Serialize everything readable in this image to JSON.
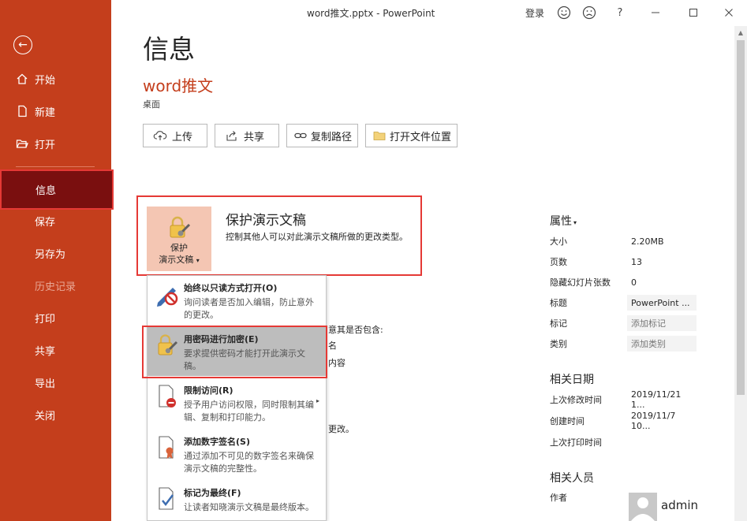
{
  "window": {
    "title": "word推文.pptx  -  PowerPoint",
    "login_label": "登录",
    "help_label": "?",
    "icons": [
      "smile-icon",
      "frown-icon",
      "help-icon",
      "minimize-icon",
      "maximize-icon",
      "close-icon"
    ]
  },
  "sidebar": {
    "items": [
      {
        "label": "开始",
        "icon": "home-icon"
      },
      {
        "label": "新建",
        "icon": "new-file-icon"
      },
      {
        "label": "打开",
        "icon": "open-folder-icon"
      },
      {
        "label": "信息",
        "active": true
      },
      {
        "label": "保存"
      },
      {
        "label": "另存为"
      },
      {
        "label": "历史记录",
        "disabled": true
      },
      {
        "label": "打印"
      },
      {
        "label": "共享"
      },
      {
        "label": "导出"
      },
      {
        "label": "关闭"
      }
    ]
  },
  "main": {
    "title": "信息",
    "doc_name": "word推文",
    "doc_location": "桌面",
    "actions": [
      {
        "label": "上传",
        "icon": "upload-cloud-icon"
      },
      {
        "label": "共享",
        "icon": "share-icon"
      },
      {
        "label": "复制路径",
        "icon": "link-icon"
      },
      {
        "label": "打开文件位置",
        "icon": "folder-icon"
      }
    ],
    "protect": {
      "tile_line1": "保护",
      "tile_line2": "演示文稿",
      "tile_caret": "▾",
      "heading": "保护演示文稿",
      "description": "控制其他人可以对此演示文稿所做的更改类型。"
    },
    "background_fragments": [
      "意其是否包含:",
      "名",
      "内容",
      "更改。"
    ]
  },
  "menu": {
    "items": [
      {
        "title": "始终以只读方式打开(O)",
        "desc": "询问读者是否加入编辑，防止意外的更改。",
        "icon": "pen-prohibited-icon"
      },
      {
        "title": "用密码进行加密(E)",
        "desc": "要求提供密码才能打开此演示文稿。",
        "icon": "lock-key-icon",
        "highlighted": true
      },
      {
        "title": "限制访问(R)",
        "desc": "授予用户访问权限，同时限制其编辑、复制和打印能力。",
        "icon": "restrict-document-icon",
        "has_submenu": true,
        "submenu_arrow": "▸"
      },
      {
        "title": "添加数字签名(S)",
        "desc": "通过添加不可见的数字签名来确保演示文稿的完整性。",
        "icon": "signature-ribbon-icon"
      },
      {
        "title": "标记为最终(F)",
        "desc": "让读者知晓演示文稿是最终版本。",
        "icon": "mark-final-icon"
      }
    ]
  },
  "properties": {
    "heading": "属性",
    "heading_caret": "▾",
    "rows": [
      {
        "label": "大小",
        "value": "2.20MB"
      },
      {
        "label": "页数",
        "value": "13"
      },
      {
        "label": "隐藏幻灯片张数",
        "value": "0"
      },
      {
        "label": "标题",
        "value": "PowerPoint ..."
      },
      {
        "label": "标记",
        "value": "添加标记"
      },
      {
        "label": "类别",
        "value": "添加类别"
      }
    ],
    "dates_heading": "相关日期",
    "dates": [
      {
        "label": "上次修改时间",
        "value": "2019/11/21 1..."
      },
      {
        "label": "创建时间",
        "value": "2019/11/7 10..."
      },
      {
        "label": "上次打印时间",
        "value": ""
      }
    ],
    "people_heading": "相关人员",
    "author_label": "作者",
    "author_name": "admin"
  },
  "colors": {
    "sidebar_bg": "#c43e1c",
    "sidebar_active": "#7a0f0f",
    "accent_red": "#c43e1c",
    "annotation_red": "#e53935",
    "protect_tile": "#f4c6b3"
  }
}
